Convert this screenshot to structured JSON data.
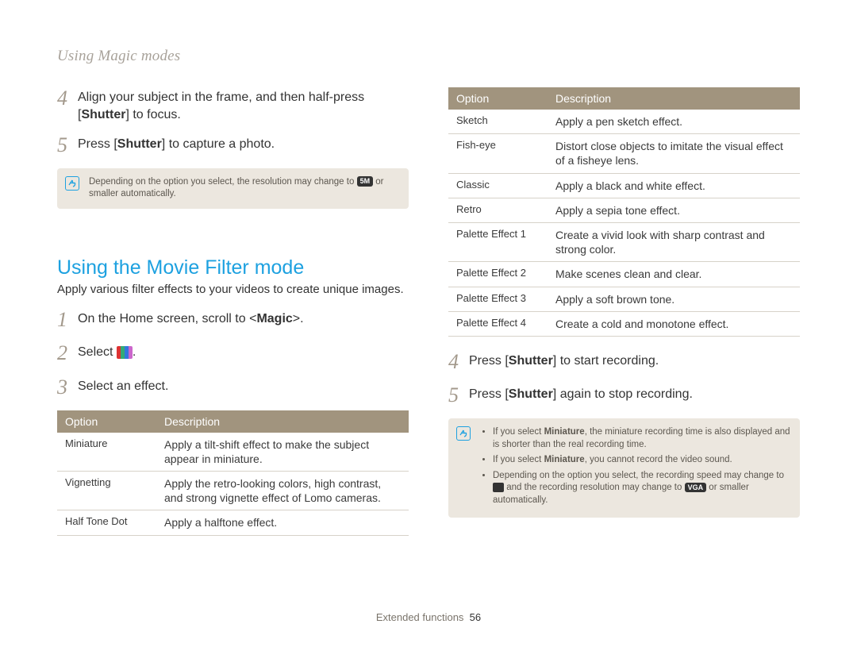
{
  "header": "Using Magic modes",
  "left": {
    "steps1": [
      {
        "num": "4",
        "prefix": "Align your subject in the frame, and then half-press [",
        "bold": "Shutter",
        "suffix": "] to focus."
      },
      {
        "num": "5",
        "prefix": "Press [",
        "bold": "Shutter",
        "suffix": "] to capture a photo."
      }
    ],
    "note1_a": "Depending on the option you select, the resolution may change to ",
    "note1_badge": "5M",
    "note1_b": " or smaller automatically.",
    "section_title": "Using the Movie Filter mode",
    "section_sub": "Apply various filter effects to your videos to create unique images.",
    "steps2": [
      {
        "num": "1",
        "html": "On the Home screen, scroll to <<b>Magic</b>>."
      },
      {
        "num": "2",
        "html": "Select <span class='movie-icon'></span>."
      },
      {
        "num": "3",
        "html": "Select an effect."
      }
    ],
    "table_header": {
      "c1": "Option",
      "c2": "Description"
    },
    "table_rows": [
      {
        "opt": "Miniature",
        "desc": "Apply a tilt-shift effect to make the subject appear in miniature."
      },
      {
        "opt": "Vignetting",
        "desc": "Apply the retro-looking colors, high contrast, and strong vignette effect of Lomo cameras."
      },
      {
        "opt": "Half Tone Dot",
        "desc": "Apply a halftone effect."
      }
    ]
  },
  "right": {
    "table_header": {
      "c1": "Option",
      "c2": "Description"
    },
    "table_rows": [
      {
        "opt": "Sketch",
        "desc": "Apply a pen sketch effect."
      },
      {
        "opt": "Fish-eye",
        "desc": "Distort close objects to imitate the visual effect of a fisheye lens."
      },
      {
        "opt": "Classic",
        "desc": "Apply a black and white effect."
      },
      {
        "opt": "Retro",
        "desc": "Apply a sepia tone effect."
      },
      {
        "opt": "Palette Effect 1",
        "desc": "Create a vivid look with sharp contrast and strong color."
      },
      {
        "opt": "Palette Effect 2",
        "desc": "Make scenes clean and clear."
      },
      {
        "opt": "Palette Effect 3",
        "desc": "Apply a soft brown tone."
      },
      {
        "opt": "Palette Effect 4",
        "desc": "Create a cold and monotone effect."
      }
    ],
    "steps": [
      {
        "num": "4",
        "prefix": "Press [",
        "bold": "Shutter",
        "suffix": "] to start recording."
      },
      {
        "num": "5",
        "prefix": "Press [",
        "bold": "Shutter",
        "suffix": "] again to stop recording."
      }
    ],
    "note_items": [
      "If you select <b>Miniature</b>, the miniature recording time is also displayed and is shorter than the real recording time.",
      "If you select <b>Miniature</b>, you cannot record the video sound.",
      "Depending on the option you select, the recording speed may change to <span class='tiny-dark-icon'></span> and the recording resolution may change to <span class='inline-icon'>VGA</span> or smaller automatically."
    ]
  },
  "footer": {
    "label": "Extended functions",
    "page": "56"
  }
}
